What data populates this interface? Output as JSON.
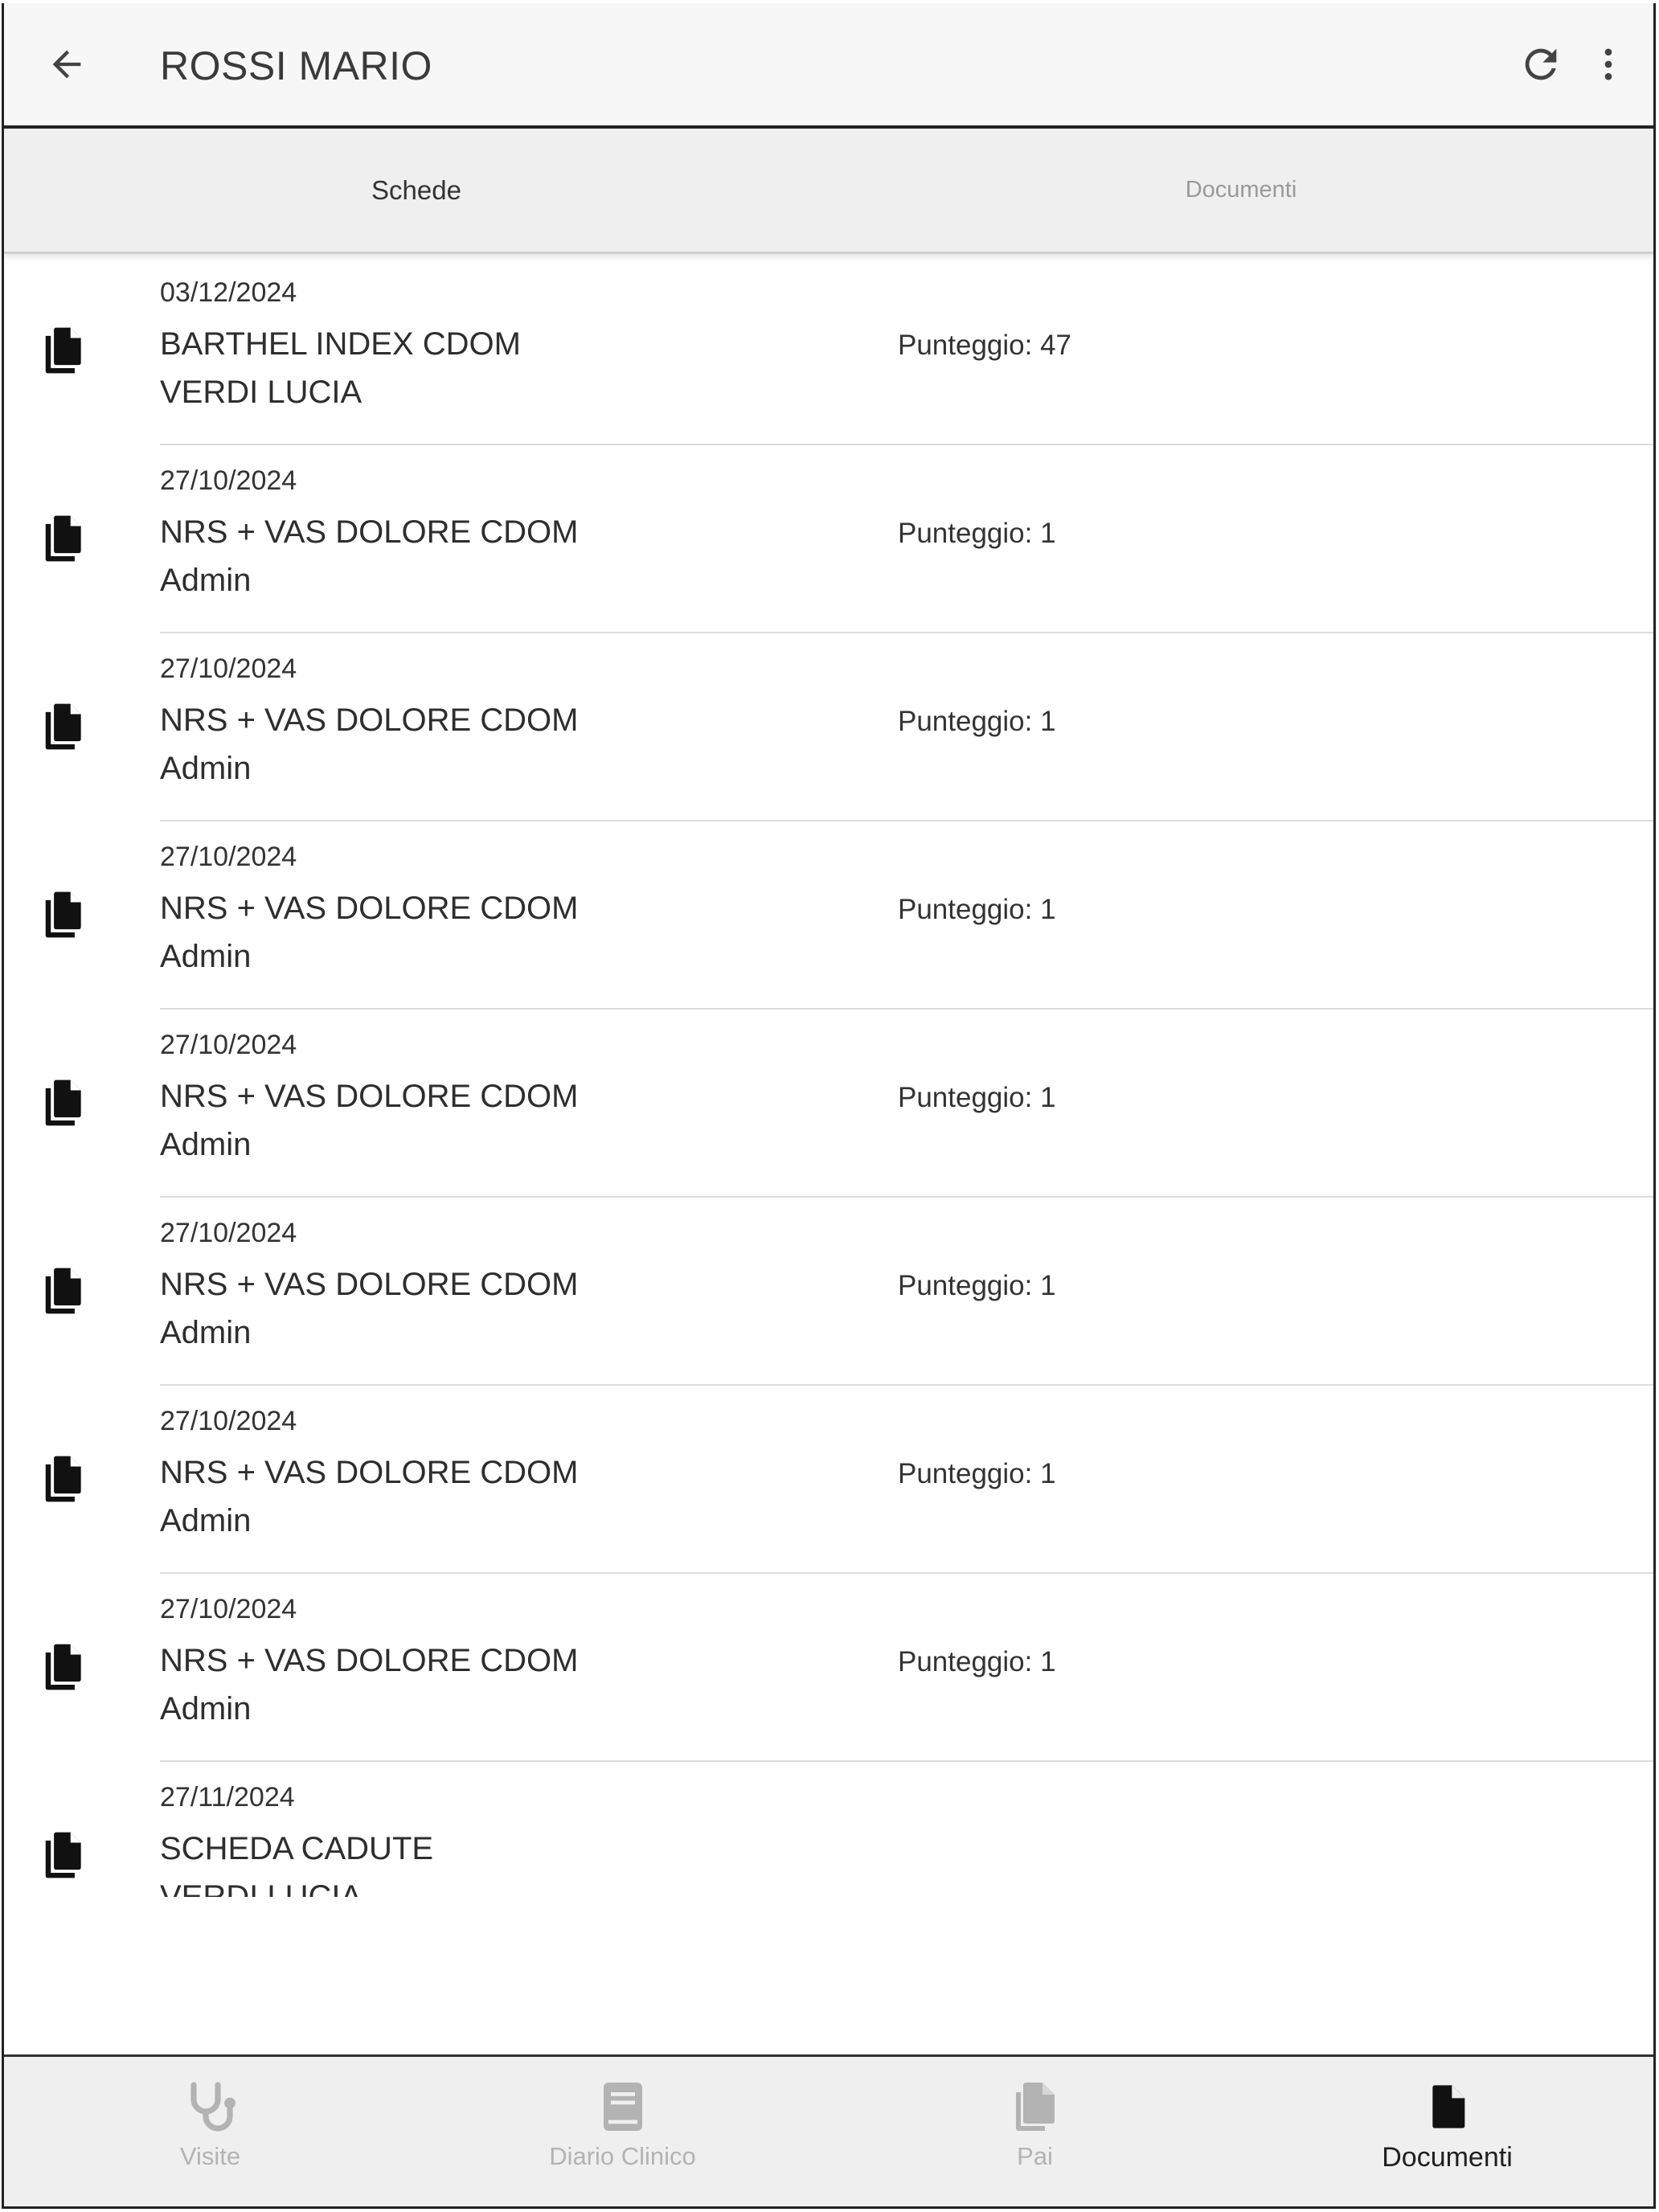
{
  "header": {
    "title": "ROSSI MARIO",
    "back_icon": "arrow-left-icon",
    "refresh_icon": "refresh-icon",
    "more_icon": "more-vertical-icon"
  },
  "tabs": [
    {
      "label": "Schede",
      "active": true
    },
    {
      "label": "Documenti",
      "active": false
    }
  ],
  "items": [
    {
      "date": "03/12/2024",
      "title": "BARTHEL INDEX CDOM",
      "author": "VERDI LUCIA",
      "score": "Punteggio: 47"
    },
    {
      "date": "27/10/2024",
      "title": "NRS + VAS DOLORE CDOM",
      "author": "Admin",
      "score": "Punteggio: 1"
    },
    {
      "date": "27/10/2024",
      "title": "NRS + VAS DOLORE CDOM",
      "author": "Admin",
      "score": "Punteggio: 1"
    },
    {
      "date": "27/10/2024",
      "title": "NRS + VAS DOLORE CDOM",
      "author": "Admin",
      "score": "Punteggio: 1"
    },
    {
      "date": "27/10/2024",
      "title": "NRS + VAS DOLORE CDOM",
      "author": "Admin",
      "score": "Punteggio: 1"
    },
    {
      "date": "27/10/2024",
      "title": "NRS + VAS DOLORE CDOM",
      "author": "Admin",
      "score": "Punteggio: 1"
    },
    {
      "date": "27/10/2024",
      "title": "NRS + VAS DOLORE CDOM",
      "author": "Admin",
      "score": "Punteggio: 1"
    },
    {
      "date": "27/10/2024",
      "title": "NRS + VAS DOLORE CDOM",
      "author": "Admin",
      "score": "Punteggio: 1"
    },
    {
      "date": "27/11/2024",
      "title": "SCHEDA CADUTE",
      "author": "VERDI LUCIA",
      "score": ""
    }
  ],
  "bottom_nav": [
    {
      "label": "Visite",
      "icon": "stethoscope-icon",
      "active": false
    },
    {
      "label": "Diario Clinico",
      "icon": "book-icon",
      "active": false
    },
    {
      "label": "Pai",
      "icon": "clipboard-copy-icon",
      "active": false
    },
    {
      "label": "Documenti",
      "icon": "document-icon",
      "active": true
    }
  ],
  "colors": {
    "active": "#1f1f1f",
    "inactive": "#b3b3b3",
    "bar_background": "#efefef"
  }
}
